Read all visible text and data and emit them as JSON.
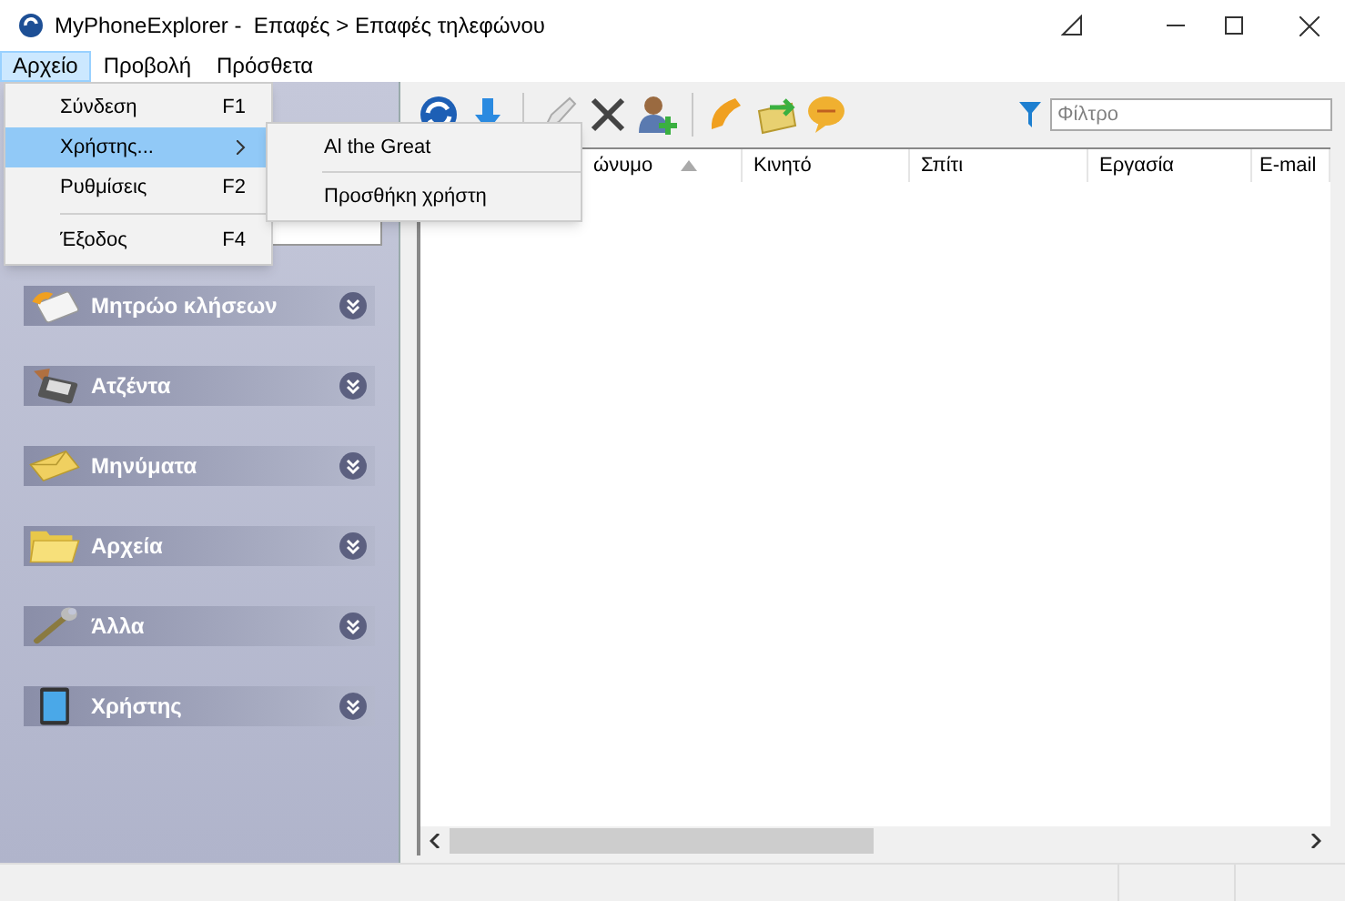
{
  "window": {
    "title": "MyPhoneExplorer -  Επαφές > Επαφές τηλεφώνου"
  },
  "menubar": [
    {
      "label": "Αρχείο",
      "selected": true
    },
    {
      "label": "Προβολή",
      "selected": false
    },
    {
      "label": "Πρόσθετα",
      "selected": false
    }
  ],
  "dropdown": [
    {
      "label": "Σύνδεση",
      "shortcut": "F1",
      "submenu": false,
      "selected": false,
      "separator_after": false
    },
    {
      "label": "Χρήστης...",
      "submenu": true,
      "selected": true,
      "separator_after": false
    },
    {
      "label": "Ρυθμίσεις",
      "shortcut": "F2",
      "submenu": false,
      "selected": false,
      "separator_after": true
    },
    {
      "label": "Έξοδος",
      "shortcut": "F4",
      "submenu": false,
      "selected": false,
      "separator_after": false
    }
  ],
  "submenu": [
    {
      "label": "Al the Great"
    },
    {
      "label": "Προσθήκη χρήστη"
    }
  ],
  "sidebar": {
    "groups": [
      {
        "label": "Μητρώο κλήσεων"
      },
      {
        "label": "Ατζέντα"
      },
      {
        "label": "Μηνύματα"
      },
      {
        "label": "Αρχεία"
      },
      {
        "label": "Άλλα"
      },
      {
        "label": "Χρήστης"
      }
    ]
  },
  "toolbar": {
    "filter": {
      "placeholder": "Φίλτρο"
    }
  },
  "table": {
    "columns": [
      {
        "label": "ώνυμο",
        "sorted": true
      },
      {
        "label": "Κινητό",
        "sorted": false
      },
      {
        "label": "Σπίτι",
        "sorted": false
      },
      {
        "label": "Εργασία",
        "sorted": false
      },
      {
        "label": "E-mail",
        "sorted": false
      }
    ]
  }
}
